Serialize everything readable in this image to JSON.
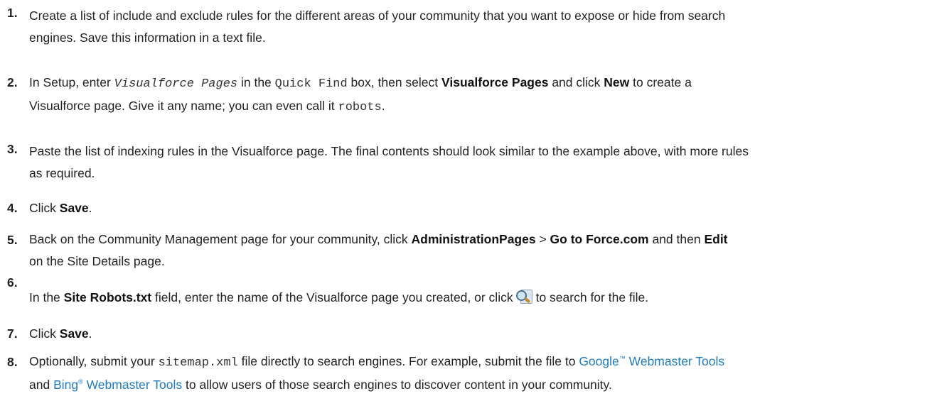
{
  "steps": [
    {
      "number": "1.",
      "lines": [
        "Create a list of include and exclude rules for the different areas of your community that you want to expose or hide from search",
        "engines. Save this information in a text file."
      ]
    },
    {
      "number": "2.",
      "p1": "In Setup, enter ",
      "code1": "Visualforce Pages",
      "p2": " in the ",
      "code2": "Quick Find",
      "p3": " box, then select ",
      "b1": "Visualforce Pages",
      "p4": " and click ",
      "b2": "New",
      "p5": " to create a",
      "l2a": "Visualforce page. Give it any name; you can even call it ",
      "code3": "robots",
      "l2b": "."
    },
    {
      "number": "3.",
      "lines": [
        "Paste the list of indexing rules in the Visualforce page. The final contents should look similar to the example above, with more rules",
        "as required."
      ]
    },
    {
      "number": "4.",
      "p1": "Click ",
      "b1": "Save",
      "p2": "."
    },
    {
      "number": "5.",
      "p1": "Back on the Community Management page for your community, click ",
      "b1": "AdministrationPages",
      "p2": " > ",
      "b2": "Go to Force.com",
      "p3": " and then ",
      "b3": "Edit",
      "l2": "on the Site Details page."
    },
    {
      "number": "6.",
      "p1": "In the ",
      "b1": "Site Robots.txt",
      "p2": " field, enter the name of the Visualforce page you created, or click",
      "p3": "to search for the file."
    },
    {
      "number": "7.",
      "p1": "Click ",
      "b1": "Save",
      "p2": "."
    },
    {
      "number": "8.",
      "p1": "Optionally, submit your ",
      "code1": "sitemap.xml",
      "p2": " file directly to search engines. For example, submit the file to ",
      "link1": "Google",
      "link1_sup": "™",
      "link1_rest": " Webmaster Tools",
      "l2a": "and ",
      "link2": "Bing",
      "link2_sup": "®",
      "link2_rest": " Webmaster Tools",
      "l2b": " to allow users of those search engines to discover content in your community."
    }
  ]
}
